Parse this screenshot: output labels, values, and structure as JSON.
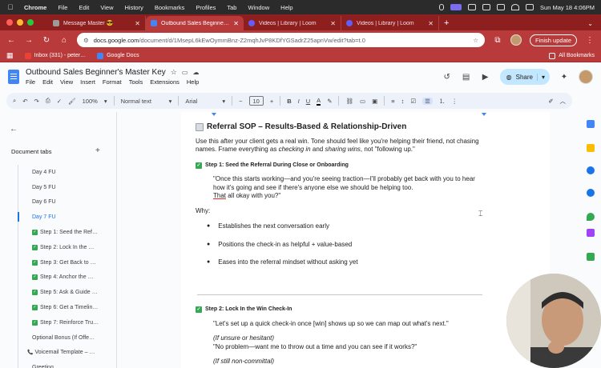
{
  "menubar": {
    "app": "Chrome",
    "items": [
      "File",
      "Edit",
      "View",
      "History",
      "Bookmarks",
      "Profiles",
      "Tab",
      "Window",
      "Help"
    ],
    "datetime": "Sun May 18  4:06PM"
  },
  "tabs": [
    {
      "title": "Message Master 😎",
      "color": "#9b9b9b"
    },
    {
      "title": "Outbound Sales Beginner's Ma…",
      "color": "#4285f4"
    },
    {
      "title": "Videos | Library | Loom",
      "color": "#625df5"
    },
    {
      "title": "Videos | Library | Loom",
      "color": "#625df5"
    }
  ],
  "toolbar": {
    "url_host": "docs.google.com",
    "url_path": "/document/d/1MsepL6kEwOymmBnz-Z2mqhJvP8KDfYGSadrZ25apnVw/edit?tab=t.0",
    "finish_update": "Finish update"
  },
  "bookmarks": {
    "items": [
      {
        "label": "Inbox (331) - peter…",
        "color": "#ea4335"
      },
      {
        "label": "Google Docs",
        "color": "#4285f4"
      }
    ],
    "all_bookmarks": "All Bookmarks"
  },
  "docs": {
    "title": "Outbound Sales Beginner's Master Key",
    "menu": [
      "File",
      "Edit",
      "View",
      "Insert",
      "Format",
      "Tools",
      "Extensions",
      "Help"
    ],
    "share_label": "Share"
  },
  "formatbar": {
    "zoom": "100%",
    "style": "Normal text",
    "font": "Arial",
    "size": "10"
  },
  "sidebar": {
    "title": "Document tabs",
    "items": [
      {
        "label": "Day 4 FU",
        "check": false,
        "active": false
      },
      {
        "label": "Day 5 FU",
        "check": false,
        "active": false
      },
      {
        "label": "Day 6 FU",
        "check": false,
        "active": false
      },
      {
        "label": "Day 7 FU",
        "check": false,
        "active": true
      },
      {
        "label": "Step 1: Seed the Ref…",
        "check": true,
        "active": false
      },
      {
        "label": "Step 2: Lock In the …",
        "check": true,
        "active": false
      },
      {
        "label": "Step 3: Get Back to …",
        "check": true,
        "active": false
      },
      {
        "label": "Step 4: Anchor the …",
        "check": true,
        "active": false
      },
      {
        "label": "Step 5: Ask & Guide …",
        "check": true,
        "active": false
      },
      {
        "label": "Step 6: Get a Timelin…",
        "check": true,
        "active": false
      },
      {
        "label": "Step 7: Reinforce Tru…",
        "check": true,
        "active": false
      },
      {
        "label": "Optional Bonus (If Offe…",
        "check": false,
        "active": false
      },
      {
        "label": "Voicemail Template – …",
        "check": false,
        "active": false,
        "top": true
      },
      {
        "label": "Greeting",
        "check": false,
        "active": false
      }
    ]
  },
  "document": {
    "heading": "Referral SOP – Results-Based & Relationship-Driven",
    "intro_1": "Use this after your client gets a real win. Tone should feel like you're helping their friend, not chasing names. Frame everything as ",
    "intro_em1": "checking in",
    "intro_2": " and ",
    "intro_em2": "sharing wins",
    "intro_3": ", not \"following up.\"",
    "step1": "Step 1: Seed the Referral During Close or Onboarding",
    "quote1_a": "\"Once this starts working—and you're seeing traction—I'll probably get back with you to hear how it's going and see if there's anyone else we should be helping too.",
    "quote1_ul": "That",
    "quote1_b": " all okay with you?\"",
    "why": "Why:",
    "bullets": [
      "Establishes the next conversation early",
      "Positions the check-in as helpful + value-based",
      "Eases into the referral mindset without asking yet"
    ],
    "step2": "Step 2: Lock In the Win Check-In",
    "quote2": "\"Let's set up a quick check-in once [win] shows up so we can map out what's next.\"",
    "unsure": "(If unsure or hesitant)",
    "unsure_quote": "\"No problem—want me to throw out a time and you can see if it works?\"",
    "noncommittal": "(If still non-committal)"
  }
}
